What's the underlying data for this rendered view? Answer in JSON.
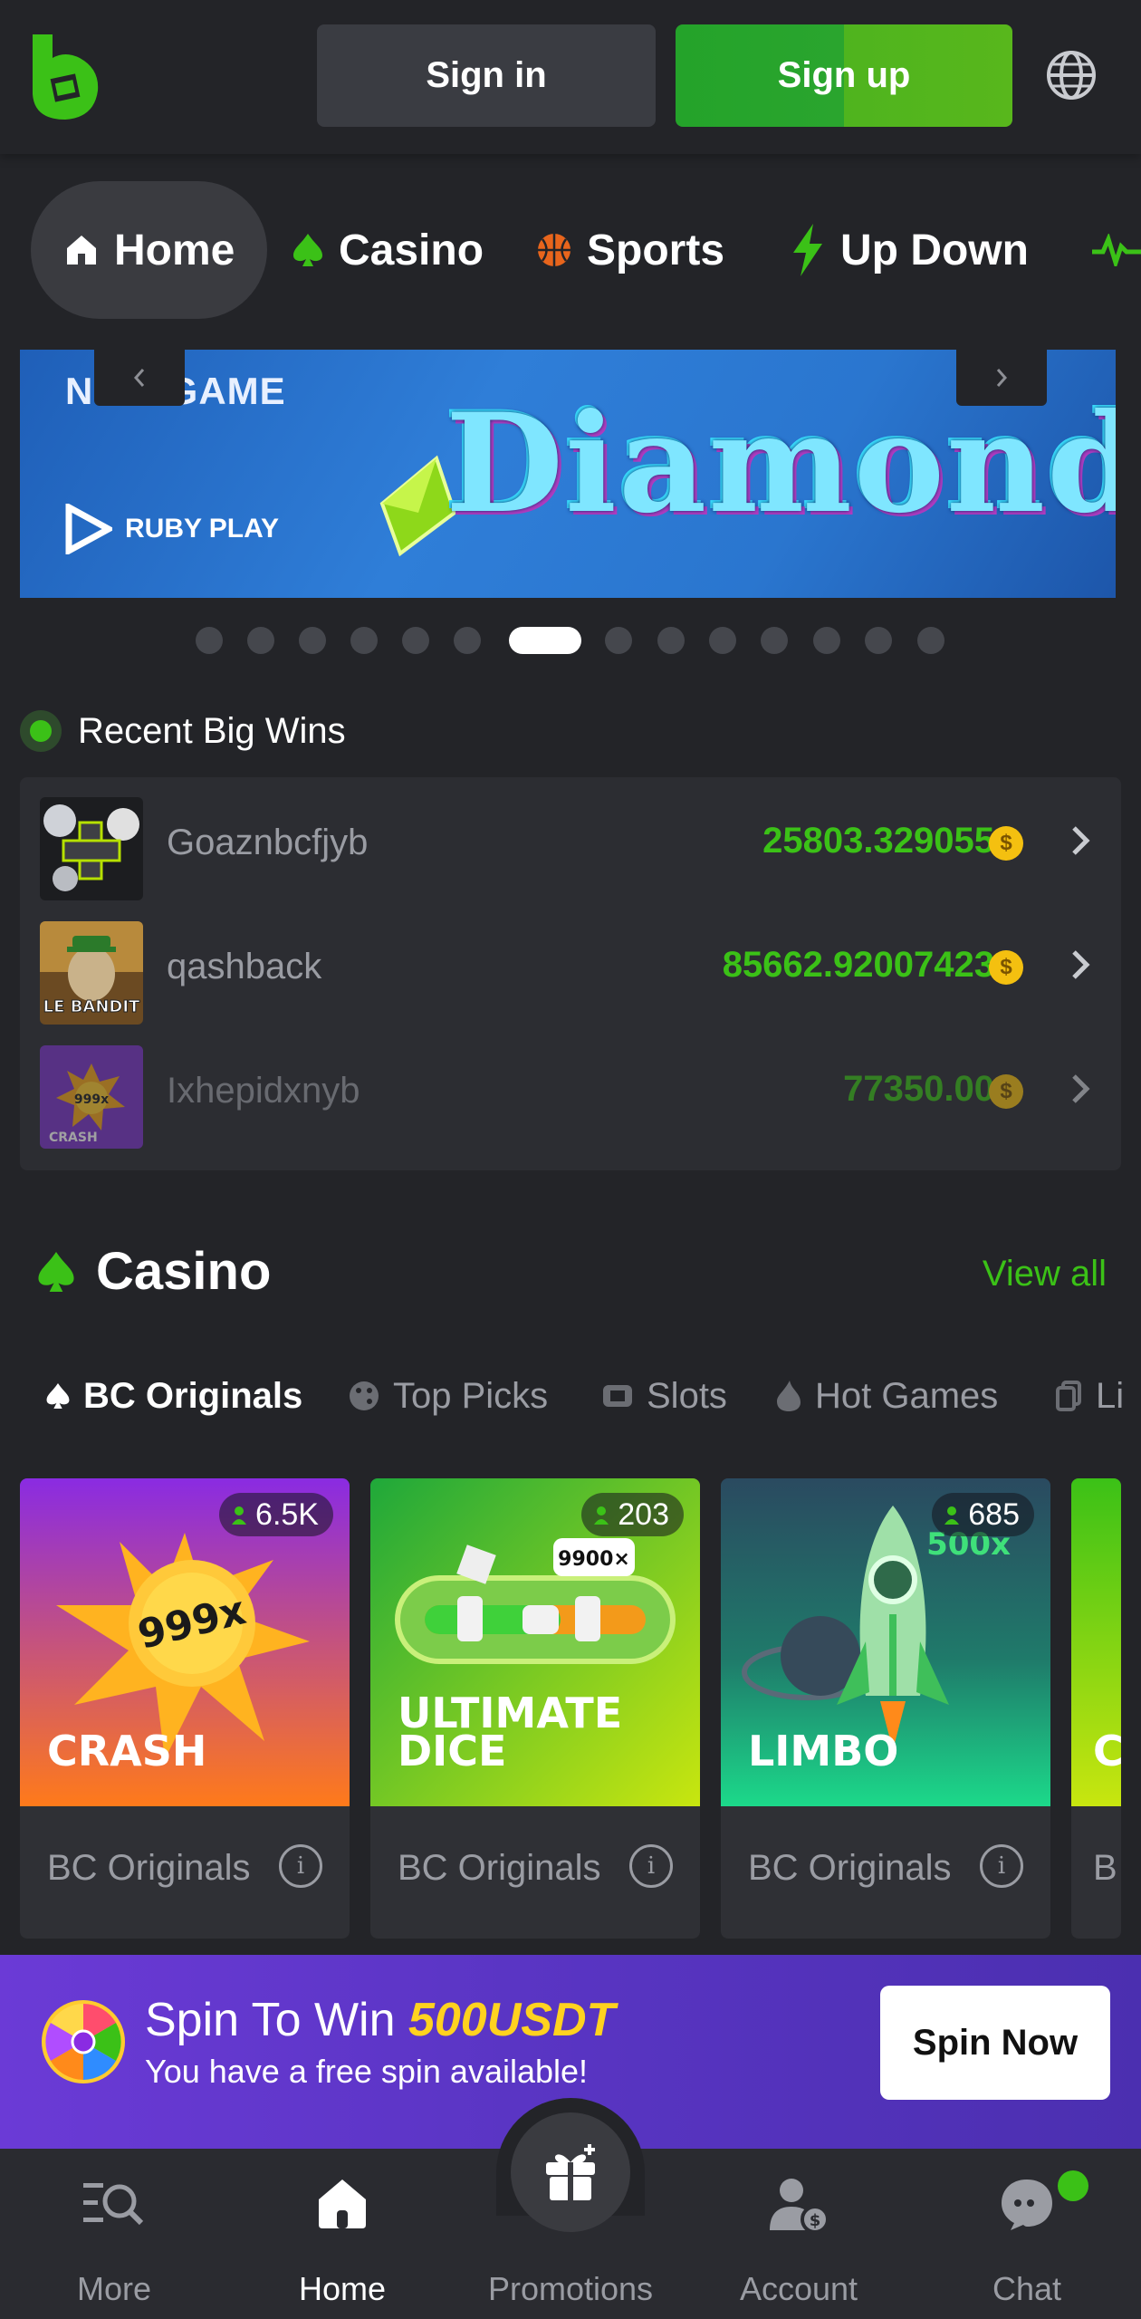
{
  "header": {
    "signin_label": "Sign in",
    "signup_label": "Sign up",
    "logo_icon": "bc-game-logo-icon",
    "language_icon": "globe-icon",
    "colors": {
      "brand_green": "#3bc117",
      "signup_green": "#24a32a"
    }
  },
  "nav": {
    "tabs": [
      {
        "label": "Home",
        "icon": "home-icon"
      },
      {
        "label": "Casino",
        "icon": "spade-icon"
      },
      {
        "label": "Sports",
        "icon": "basketball-icon"
      },
      {
        "label": "Up Down",
        "icon": "lightning-icon"
      }
    ]
  },
  "banner": {
    "tag": "NEW GAME",
    "provider": "RUBY PLAY",
    "title": "Diamonds",
    "prev_icon": "chevron-left-icon",
    "next_icon": "chevron-right-icon",
    "slide_count": 14,
    "active_slide": 7
  },
  "recent_big_wins": {
    "title": "Recent Big Wins",
    "rows": [
      {
        "user": "Goaznbcfjyb",
        "amount": "25803.329055",
        "game": "crypto-cross"
      },
      {
        "user": "qashback",
        "amount": "85662.92007423",
        "game": "le-bandit"
      },
      {
        "user": "Ixhepidxnyb",
        "amount": "77350.00",
        "game": "crash"
      }
    ],
    "coin_symbol": "$",
    "thumb_texts": {
      "le_bandit": "LE BANDIT",
      "crash": "CRASH",
      "crash_multiplier": "999x"
    }
  },
  "casino": {
    "title": "Casino",
    "view_all": "View all",
    "subtabs": [
      "BC Originals",
      "Top Picks",
      "Slots",
      "Hot Games",
      "Li"
    ],
    "cards": [
      {
        "title": "CRASH",
        "players": "6.5K",
        "category": "BC Originals",
        "art_text": "999x"
      },
      {
        "title": "ULTIMATE DICE",
        "players": "203",
        "category": "BC Originals",
        "art_text": "9900×"
      },
      {
        "title": "LIMBO",
        "players": "685",
        "category": "BC Originals",
        "art_text": "500x"
      },
      {
        "title": "C",
        "category": "B"
      }
    ]
  },
  "spin": {
    "title_prefix": "Spin To Win ",
    "amount": "500USDT",
    "subtitle": "You have a free spin available!",
    "button": "Spin Now"
  },
  "bottom_nav": {
    "items": [
      {
        "label": "More",
        "icon": "menu-search-icon"
      },
      {
        "label": "Home",
        "icon": "home-icon"
      },
      {
        "label": "Promotions",
        "icon": "gift-icon"
      },
      {
        "label": "Account",
        "icon": "account-icon"
      },
      {
        "label": "Chat",
        "icon": "chat-icon"
      }
    ],
    "active": "Home"
  }
}
